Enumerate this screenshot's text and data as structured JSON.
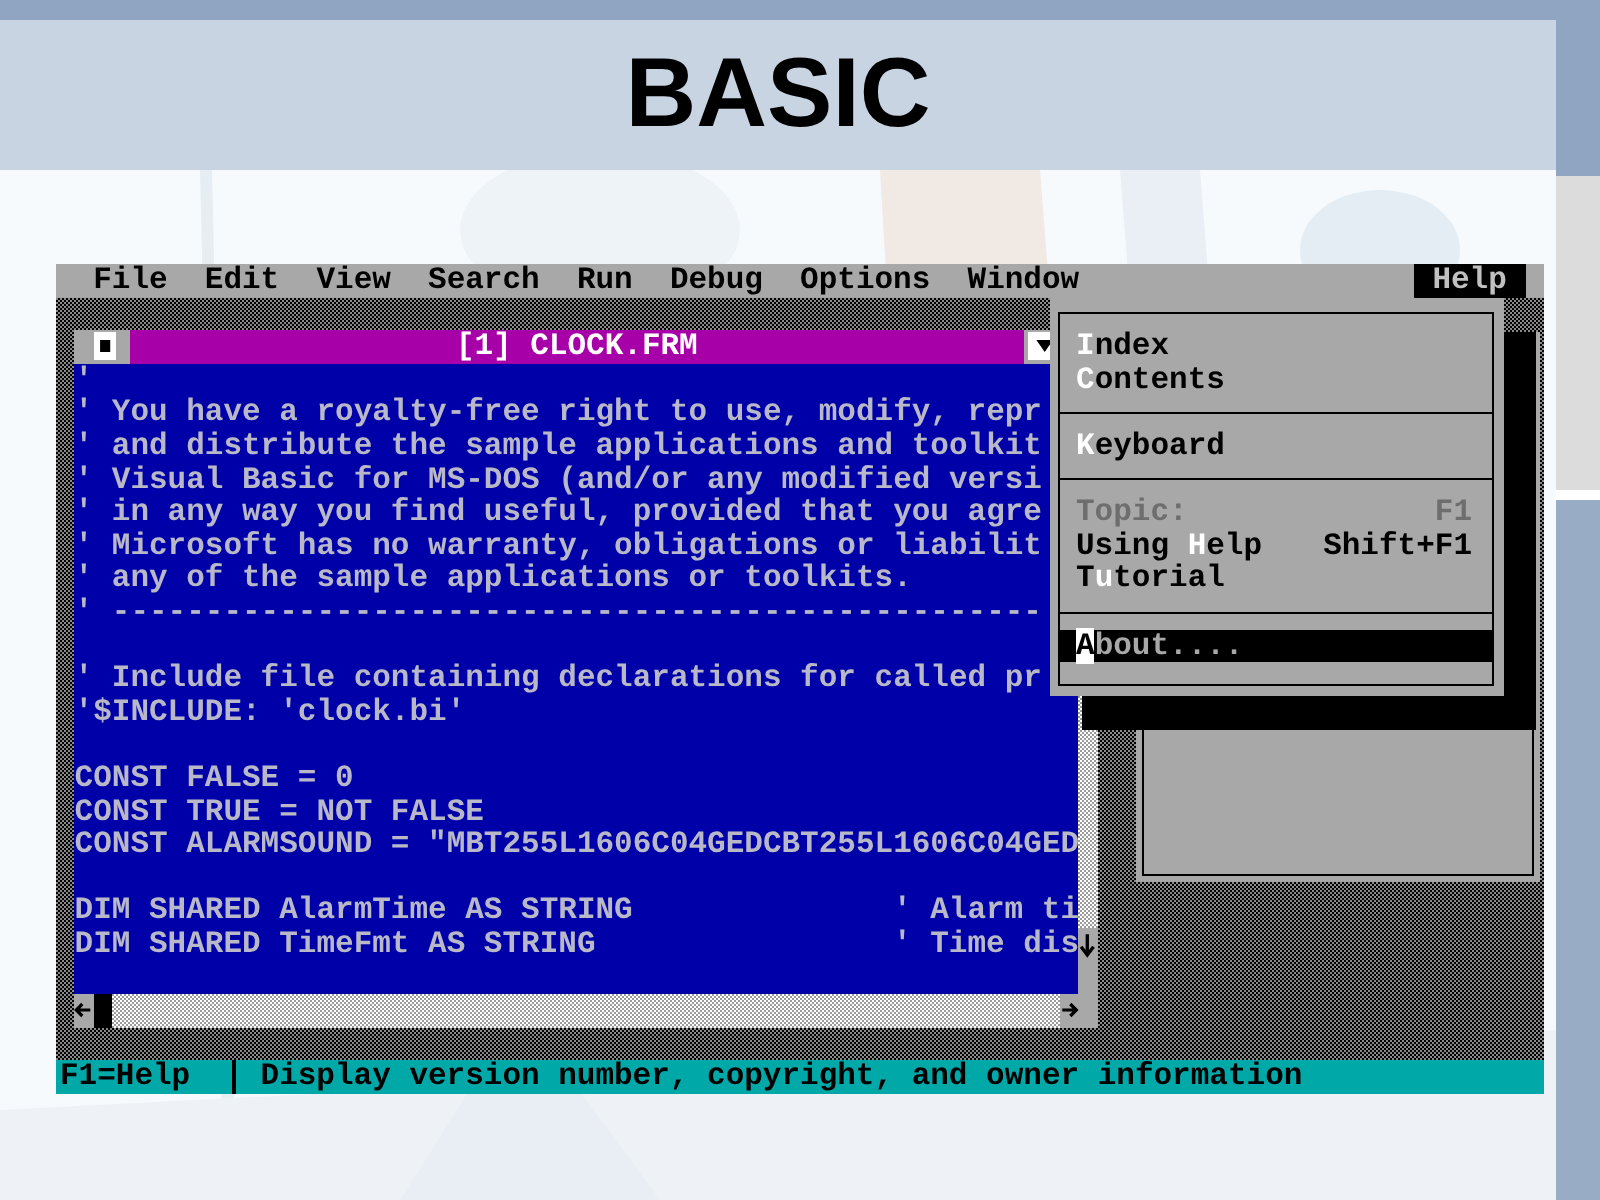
{
  "slide": {
    "title": "BASIC"
  },
  "menu_bar": [
    {
      "label": "File",
      "selected": false
    },
    {
      "label": "Edit",
      "selected": false
    },
    {
      "label": "View",
      "selected": false
    },
    {
      "label": "Search",
      "selected": false
    },
    {
      "label": "Run",
      "selected": false
    },
    {
      "label": "Debug",
      "selected": false
    },
    {
      "label": "Options",
      "selected": false
    },
    {
      "label": "Window",
      "selected": false
    },
    {
      "label": "Help",
      "selected": true
    }
  ],
  "code_window": {
    "title": "[1] CLOCK.FRM",
    "lines": [
      {
        "kind": "code",
        "text": "'"
      },
      {
        "kind": "code",
        "text": "' You have a royalty-free right to use, modify, repr"
      },
      {
        "kind": "code",
        "text": "' and distribute the sample applications and toolkit"
      },
      {
        "kind": "code",
        "text": "' Visual Basic for MS-DOS (and/or any modified versi"
      },
      {
        "kind": "code",
        "text": "' in any way you find useful, provided that you agre"
      },
      {
        "kind": "code",
        "text": "' Microsoft has no warranty, obligations or liabilit"
      },
      {
        "kind": "code",
        "text": "' any of the sample applications or toolkits."
      },
      {
        "kind": "code",
        "text": "' --------------------------------------------------"
      },
      {
        "kind": "blank"
      },
      {
        "kind": "code",
        "text": "' Include file containing declarations for called pr"
      },
      {
        "kind": "code",
        "text": "'$INCLUDE: 'clock.bi'"
      },
      {
        "kind": "blank"
      },
      {
        "kind": "code",
        "text": "CONST FALSE = 0"
      },
      {
        "kind": "code",
        "text": "CONST TRUE = NOT FALSE"
      },
      {
        "kind": "code",
        "text": "CONST ALARMSOUND = \"MBT255L1606C04GEDCBT255L1606C04GED"
      },
      {
        "kind": "blank"
      },
      {
        "kind": "code",
        "text": "DIM SHARED AlarmTime AS STRING",
        "comment": "' Alarm ti"
      },
      {
        "kind": "code",
        "text": "DIM SHARED TimeFmt AS STRING",
        "comment": "' Time dis"
      },
      {
        "kind": "blank"
      }
    ]
  },
  "help_menu": {
    "items": [
      {
        "kind": "item",
        "label": "**I**ndex",
        "selected": false,
        "disabled": false
      },
      {
        "kind": "item",
        "label": "**C**ontents",
        "selected": false,
        "disabled": false
      },
      {
        "kind": "separator"
      },
      {
        "kind": "item",
        "label": "**K**eyboard",
        "selected": false,
        "disabled": false
      },
      {
        "kind": "separator"
      },
      {
        "kind": "item",
        "label": "Topic:",
        "shortcut": "F1",
        "selected": false,
        "disabled": true
      },
      {
        "kind": "item",
        "label": "Using **H**elp",
        "shortcut": "Shift+F1",
        "selected": false,
        "disabled": false
      },
      {
        "kind": "item",
        "label": "T**u**torial",
        "selected": false,
        "disabled": false
      },
      {
        "kind": "separator"
      },
      {
        "kind": "item",
        "label": "**A**bout....",
        "selected": true,
        "disabled": false
      }
    ]
  },
  "status_bar": {
    "key_hint": "F1=Help",
    "message": "Display version number, copyright, and owner information"
  }
}
